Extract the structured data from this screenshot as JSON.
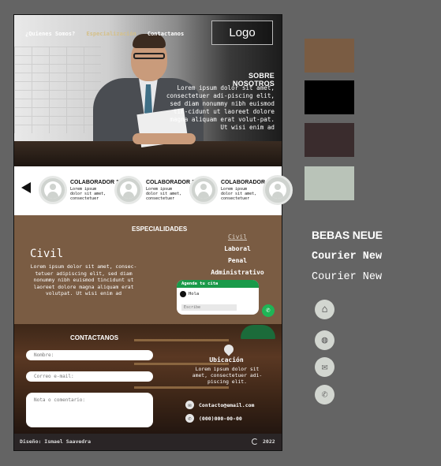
{
  "nav": {
    "items": [
      "¿Quienes Somos?",
      "Especialización",
      "Contactanos"
    ],
    "logo": "Logo"
  },
  "about": {
    "title": "SOBRE NOSOTROS",
    "text": "Lorem ipsum dolor sit amet, consectetuer adi-piscing elit, sed diam nonummy nibh euismod tin-cidunt ut laoreet dolore magna aliquam erat volut-pat. Ut wisi enim ad"
  },
  "collaborators": [
    {
      "name": "COLABORADOR 1",
      "desc": "Lorem ipsum dolor sit amet, consectetuer"
    },
    {
      "name": "COLABORADOR 1",
      "desc": "Lorem ipsum dolor sit amet, consectetuer"
    },
    {
      "name": "COLABORADOR 1",
      "desc": "Lorem ipsum dolor sit amet, consectetuer"
    }
  ],
  "specialties": {
    "title": "ESPECIALIDADES",
    "heading": "Civil",
    "text": "Lorem ipsum dolor sit amet, consec-tetuer adipiscing elit, sed diam nonummy nibh euismod tincidunt ut laoreet dolore magna aliquam erat volutpat. Ut wisi enim ad",
    "list": [
      "Civil",
      "Laboral",
      "Penal",
      "Administrativo"
    ]
  },
  "agenda": {
    "header": "Agenda tu cita",
    "greeting": "Hola",
    "input_placeholder": "Escribe"
  },
  "contact": {
    "title": "CONTACTANOS",
    "name_placeholder": "Nombre:",
    "email_placeholder": "Correo e-mail:",
    "comment_placeholder": "Nota o comentario:",
    "location_title": "Ubicación",
    "location_text": "Lorem ipsum dolor sit amet, consectetuer adi-piscing elit.",
    "email": "Contacto@email.com",
    "phone": "(000)000-00-00"
  },
  "footer": {
    "design": "Diseño: Ismael Saavedra",
    "year": "2022"
  },
  "palette": {
    "colors": [
      "#7a5c43",
      "#000000",
      "#3a2c2d",
      "#b9c3b8"
    ],
    "fonts": [
      "BEBAS NEUE",
      "Courier New",
      "Courier New"
    ],
    "icons": [
      "home-icon",
      "globe-icon",
      "mail-icon",
      "phone-icon"
    ]
  }
}
